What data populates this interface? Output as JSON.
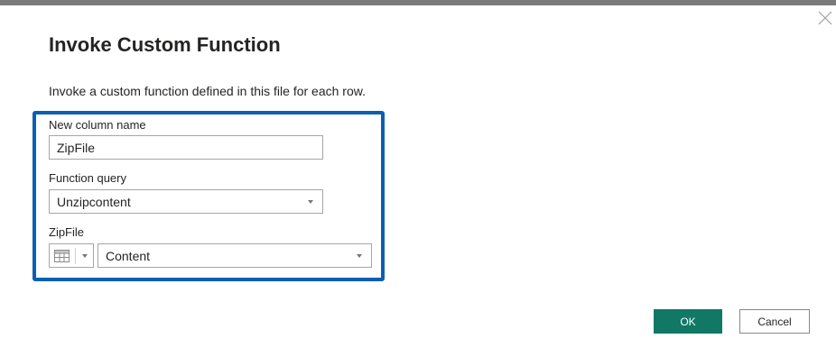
{
  "dialog": {
    "title": "Invoke Custom Function",
    "description": "Invoke a custom function defined in this file for each row."
  },
  "fields": {
    "new_column_name": {
      "label": "New column name",
      "value": "ZipFile"
    },
    "function_query": {
      "label": "Function query",
      "value": "Unzipcontent"
    },
    "zipfile": {
      "label": "ZipFile",
      "type_icon": "table-icon",
      "value": "Content"
    }
  },
  "buttons": {
    "ok": "OK",
    "cancel": "Cancel"
  },
  "colors": {
    "highlight": "#0b5fb3",
    "ok_button": "#117865"
  }
}
